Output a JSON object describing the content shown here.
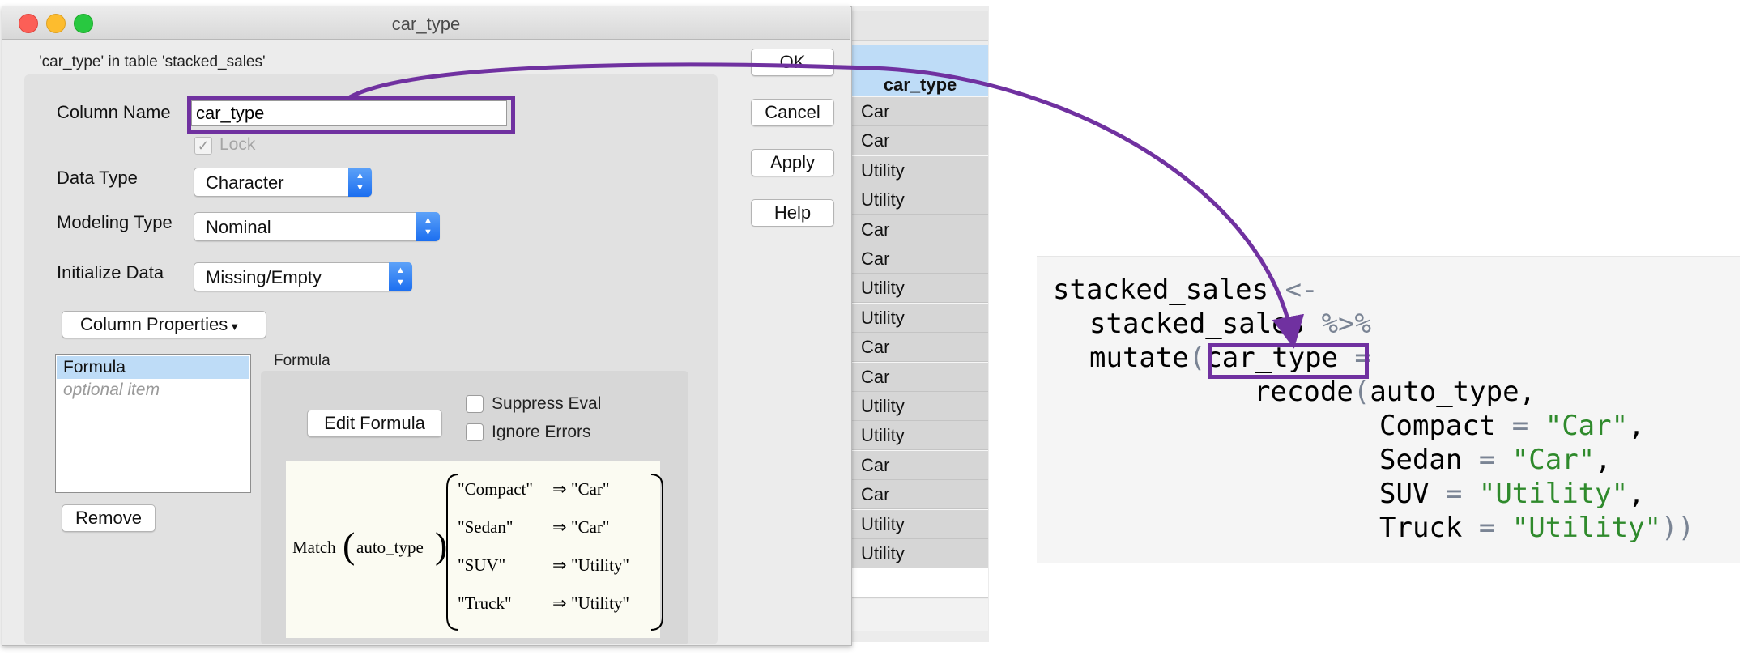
{
  "colors": {
    "annotation": "#7031a0",
    "selection": "#bedcf7",
    "string": "#2f8a2c",
    "operator": "#7a8494"
  },
  "dialog": {
    "title": "car_type",
    "context": "'car_type' in table 'stacked_sales'",
    "column_name_label": "Column Name",
    "column_name_value": "car_type",
    "lock_label": "Lock",
    "lock_checked": true,
    "data_type_label": "Data Type",
    "data_type_value": "Character",
    "modeling_type_label": "Modeling Type",
    "modeling_type_value": "Nominal",
    "initialize_label": "Initialize Data",
    "initialize_value": "Missing/Empty",
    "column_properties_label": "Column Properties",
    "properties": [
      "Formula",
      "optional item"
    ],
    "remove_label": "Remove",
    "buttons": {
      "ok": "OK",
      "cancel": "Cancel",
      "apply": "Apply",
      "help": "Help"
    },
    "formula_group_label": "Formula",
    "edit_formula_label": "Edit Formula",
    "suppress_eval_label": "Suppress Eval",
    "ignore_errors_label": "Ignore Errors",
    "formula": {
      "function": "Match",
      "argument": "auto_type",
      "arrow": "⇒",
      "rules": [
        {
          "key": "\"Compact\"",
          "value": "\"Car\""
        },
        {
          "key": "\"Sedan\"",
          "value": "\"Car\""
        },
        {
          "key": "\"SUV\"",
          "value": "\"Utility\""
        },
        {
          "key": "\"Truck\"",
          "value": "\"Utility\""
        }
      ]
    }
  },
  "table": {
    "column_header": "car_type",
    "values": [
      "Car",
      "Car",
      "Utility",
      "Utility",
      "Car",
      "Car",
      "Utility",
      "Utility",
      "Car",
      "Car",
      "Utility",
      "Utility",
      "Car",
      "Car",
      "Utility",
      "Utility"
    ]
  },
  "code": {
    "l1a": "stacked_sales ",
    "l1b": "<-",
    "l2a": "stacked_sales ",
    "l2b": "%>%",
    "l3a": "mutate",
    "l3b": "(",
    "l3c": "car_type",
    "l3d": " =",
    "l4a": "recode",
    "l4b": "(",
    "l4c": "auto_type,",
    "l5a": "Compact ",
    "l5b": "=",
    "l5c": " \"Car\"",
    "l5d": ",",
    "l6a": "Sedan ",
    "l6b": "=",
    "l6c": " \"Car\"",
    "l6d": ",",
    "l7a": "SUV ",
    "l7b": "=",
    "l7c": " \"Utility\"",
    "l7d": ",",
    "l8a": "Truck ",
    "l8b": "=",
    "l8c": " \"Utility\"",
    "l8d": "))"
  }
}
